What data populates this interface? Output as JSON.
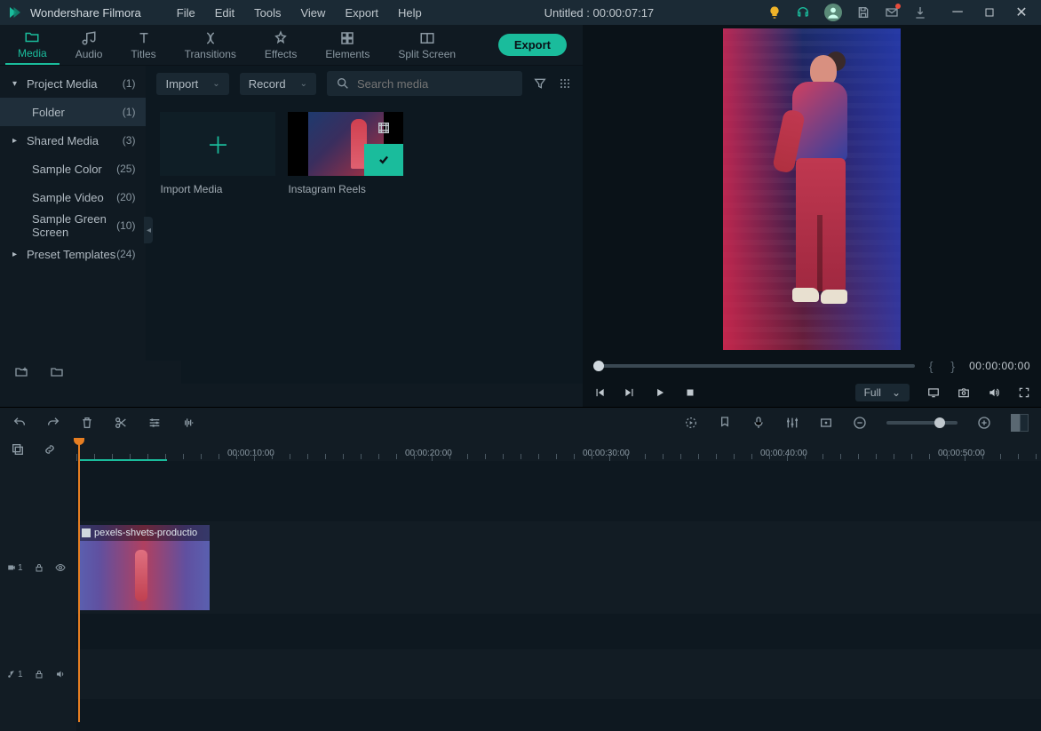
{
  "app": {
    "brand": "Wondershare Filmora"
  },
  "menu": [
    "File",
    "Edit",
    "Tools",
    "View",
    "Export",
    "Help"
  ],
  "title": "Untitled : 00:00:07:17",
  "modeTabs": [
    {
      "label": "Media",
      "icon": "folder-icon",
      "active": true
    },
    {
      "label": "Audio",
      "icon": "music-icon"
    },
    {
      "label": "Titles",
      "icon": "text-icon"
    },
    {
      "label": "Transitions",
      "icon": "transition-icon"
    },
    {
      "label": "Effects",
      "icon": "effects-icon"
    },
    {
      "label": "Elements",
      "icon": "elements-icon"
    },
    {
      "label": "Split Screen",
      "icon": "split-icon"
    }
  ],
  "exportLabel": "Export",
  "sidebar": {
    "items": [
      {
        "label": "Project Media",
        "count": "(1)",
        "level": 1,
        "chev": "▾"
      },
      {
        "label": "Folder",
        "count": "(1)",
        "level": 2,
        "selected": true
      },
      {
        "label": "Shared Media",
        "count": "(3)",
        "level": 1,
        "chev": "▸"
      },
      {
        "label": "Sample Color",
        "count": "(25)",
        "level": 2
      },
      {
        "label": "Sample Video",
        "count": "(20)",
        "level": 2
      },
      {
        "label": "Sample Green Screen",
        "count": "(10)",
        "level": 2
      },
      {
        "label": "Preset Templates",
        "count": "(24)",
        "level": 1,
        "chev": "▸"
      }
    ]
  },
  "contentBar": {
    "importLabel": "Import",
    "recordLabel": "Record",
    "searchPlaceholder": "Search media"
  },
  "thumbs": {
    "import": "Import Media",
    "clip1": "Instagram Reels"
  },
  "preview": {
    "timecode": "00:00:00:00",
    "quality": "Full"
  },
  "timeline": {
    "ruler": [
      "00:00:10:00",
      "00:00:20:00",
      "00:00:30:00",
      "00:00:40:00",
      "00:00:50:00"
    ],
    "videoTrack": "1",
    "audioTrack": "1",
    "clipName": "pexels-shvets-productio"
  }
}
